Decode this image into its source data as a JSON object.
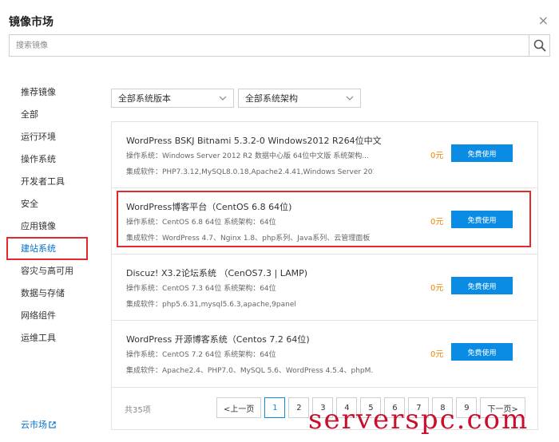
{
  "header": {
    "title": "镜像市场",
    "close_glyph": "×"
  },
  "search": {
    "placeholder": "搜索镜像",
    "value": ""
  },
  "sidebar": {
    "items": [
      {
        "label": "推荐镜像"
      },
      {
        "label": "全部"
      },
      {
        "label": "运行环境"
      },
      {
        "label": "操作系统"
      },
      {
        "label": "开发者工具"
      },
      {
        "label": "安全"
      },
      {
        "label": "应用镜像"
      },
      {
        "label": "建站系统"
      },
      {
        "label": "容灾与高可用"
      },
      {
        "label": "数据与存储"
      },
      {
        "label": "网络组件"
      },
      {
        "label": "运维工具"
      }
    ],
    "active_index": 7,
    "cloud_link": "云市场"
  },
  "filters": {
    "version": {
      "selected": "全部系统版本"
    },
    "arch": {
      "selected": "全部系统架构"
    }
  },
  "list": {
    "items": [
      {
        "name": "WordPress BSKJ Bitnami 5.3.2-0 Windows2012 R264位中文...",
        "os": "操作系统：Windows Server 2012 R2 数据中心版 64位中文版   系统架构...",
        "software": "集成软件：PHP7.3.12,MySQL8.0.18,Apache2.4.41,Windows Server 201...",
        "price": "0元",
        "action": "免费使用"
      },
      {
        "name": "WordPress博客平台（CentOS 6.8 64位)",
        "os": "操作系统：CentOS 6.8 64位   系统架构：64位",
        "software": "集成软件：WordPress 4.7、Nginx 1.8、php系列、Java系列、云管理面板",
        "price": "0元",
        "action": "免费使用"
      },
      {
        "name": "Discuz! X3.2论坛系统 （CenOS7.3 | LAMP)",
        "os": "操作系统：CentOS 7.3 64位   系统架构：64位",
        "software": "集成软件：php5.6.31,mysql5.6.3,apache,9panel",
        "price": "0元",
        "action": "免费使用"
      },
      {
        "name": "WordPress 开源博客系统（Centos 7.2 64位)",
        "os": "操作系统：CentOS 7.2 64位   系统架构：64位",
        "software": "集成软件：Apache2.4、PHP7.0、MySQL 5.6、WordPress 4.5.4、phpM...",
        "price": "0元",
        "action": "免费使用"
      }
    ],
    "highlighted_index": 1
  },
  "pagination": {
    "total": "共35项",
    "prev": "<上一页",
    "pages": [
      "1",
      "2",
      "3",
      "4",
      "5",
      "6",
      "7",
      "8",
      "9"
    ],
    "current": "1",
    "next": "下一页>"
  },
  "watermark": "serverspc.com",
  "colors": {
    "accent": "#0a8be4",
    "highlight": "#e2292c",
    "price": "#f08200",
    "link": "#0070cc"
  }
}
